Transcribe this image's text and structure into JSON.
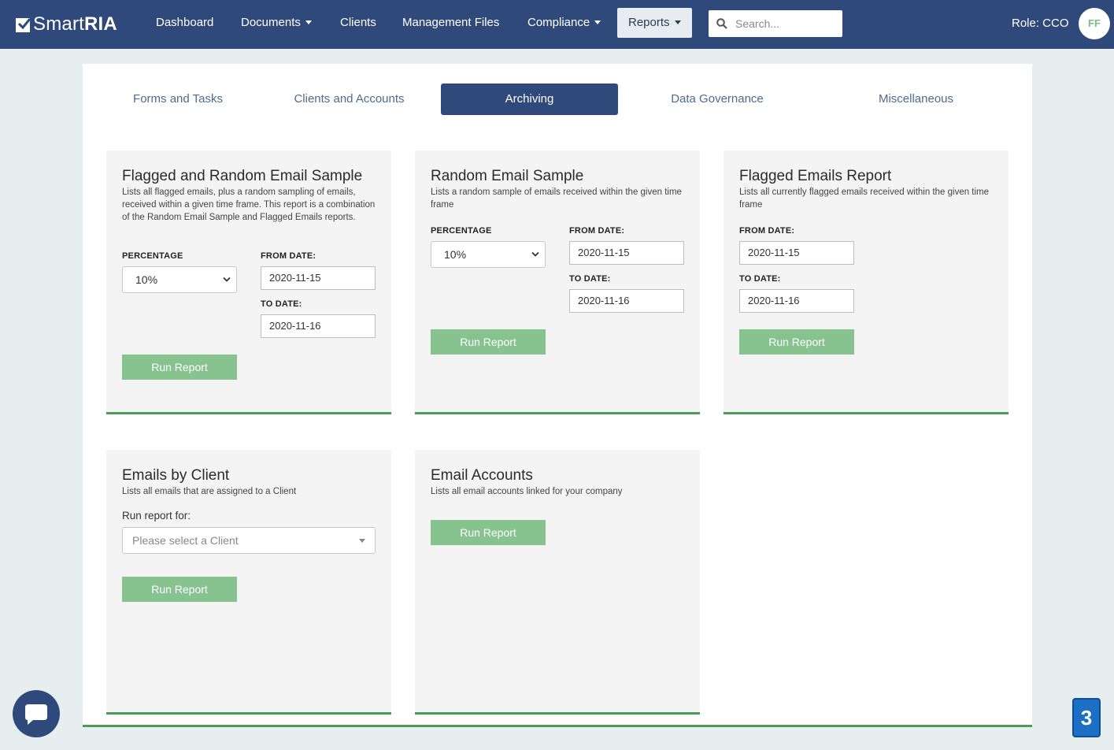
{
  "app": {
    "logo_light": "Smart",
    "logo_bold": "RIA"
  },
  "nav": {
    "dashboard": "Dashboard",
    "documents": "Documents",
    "clients": "Clients",
    "management_files": "Management Files",
    "compliance": "Compliance",
    "reports": "Reports",
    "search_placeholder": "Search...",
    "role": "Role: CCO",
    "avatar_initials": "FF"
  },
  "tabs": {
    "forms_tasks": "Forms and Tasks",
    "clients_accounts": "Clients and Accounts",
    "archiving": "Archiving",
    "data_governance": "Data Governance",
    "miscellaneous": "Miscellaneous"
  },
  "cards": {
    "flagged_random": {
      "title": "Flagged and Random Email Sample",
      "description": "Lists all flagged emails, plus a random sampling of emails, received within a given time frame. This report is a combination of the Random Email Sample and Flagged Emails reports.",
      "percentage_label": "PERCENTAGE",
      "percentage_value": "10%",
      "from_label": "FROM DATE:",
      "from_value": "2020-11-15",
      "to_label": "TO DATE:",
      "to_value": "2020-11-16",
      "button": "Run Report"
    },
    "random": {
      "title": "Random Email Sample",
      "description": "Lists a random sample of emails received within the given time frame",
      "percentage_label": "PERCENTAGE",
      "percentage_value": "10%",
      "from_label": "FROM DATE:",
      "from_value": "2020-11-15",
      "to_label": "TO DATE:",
      "to_value": "2020-11-16",
      "button": "Run Report"
    },
    "flagged": {
      "title": "Flagged Emails Report",
      "description": "Lists all currently flagged emails received within the given time frame",
      "from_label": "FROM DATE:",
      "from_value": "2020-11-15",
      "to_label": "TO DATE:",
      "to_value": "2020-11-16",
      "button": "Run Report"
    },
    "by_client": {
      "title": "Emails by Client",
      "description": "Lists all emails that are assigned to a Client",
      "run_for_label": "Run report for:",
      "client_placeholder": "Please select a Client",
      "button": "Run Report"
    },
    "accounts": {
      "title": "Email Accounts",
      "description": "Lists all email accounts linked for your company",
      "button": "Run Report"
    }
  },
  "floating": {
    "badge": "3"
  },
  "colors": {
    "navbar": "#2f4a7a",
    "accent_green": "#4a9b56",
    "button_green": "#86c38f"
  }
}
